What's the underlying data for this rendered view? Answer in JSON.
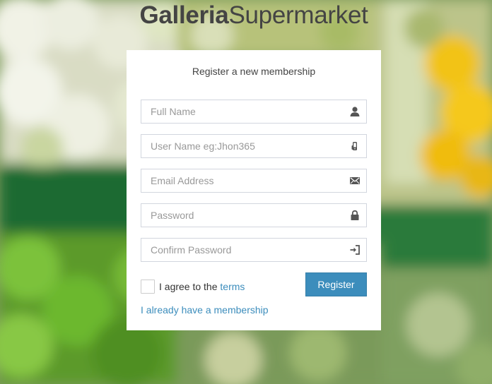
{
  "brand": {
    "bold": "Galleria",
    "light": "Supermarket"
  },
  "form": {
    "title": "Register a new membership",
    "fields": [
      {
        "placeholder": "Full Name",
        "icon": "user-icon"
      },
      {
        "placeholder": "User Name eg:Jhon365",
        "icon": "mobile-hand-icon"
      },
      {
        "placeholder": "Email Address",
        "icon": "envelope-icon"
      },
      {
        "placeholder": "Password",
        "icon": "lock-icon"
      },
      {
        "placeholder": "Confirm Password",
        "icon": "sign-in-icon"
      }
    ],
    "agree_text": "I agree to the ",
    "terms_link": "terms",
    "register_label": "Register",
    "membership_link": "I already have a membership"
  },
  "colors": {
    "accent": "#3c8dbc",
    "card_bg": "#ffffff",
    "text": "#444444"
  }
}
